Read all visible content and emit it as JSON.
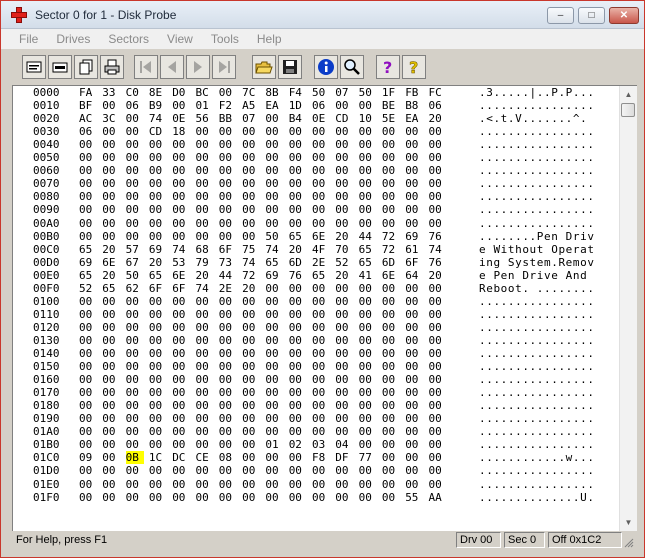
{
  "window": {
    "title": "Sector 0 for 1 - Disk Probe"
  },
  "menu": {
    "items": [
      "File",
      "Drives",
      "Sectors",
      "View",
      "Tools",
      "Help"
    ]
  },
  "toolbar": {
    "buttons": [
      {
        "icon": "read-sectors-icon",
        "enabled": true
      },
      {
        "icon": "write-sectors-icon",
        "enabled": true
      },
      {
        "icon": "copy-icon",
        "enabled": true
      },
      {
        "icon": "print-icon",
        "enabled": true
      },
      {
        "icon": "first-sector-icon",
        "enabled": false
      },
      {
        "icon": "previous-sector-icon",
        "enabled": false
      },
      {
        "icon": "next-sector-icon",
        "enabled": false
      },
      {
        "icon": "last-sector-icon",
        "enabled": false
      },
      {
        "icon": "open-folder-icon",
        "enabled": true
      },
      {
        "icon": "save-icon",
        "enabled": true
      },
      {
        "icon": "info-icon",
        "enabled": true
      },
      {
        "icon": "find-icon",
        "enabled": true
      },
      {
        "icon": "help-icon",
        "enabled": true
      },
      {
        "icon": "context-help-icon",
        "enabled": true
      }
    ]
  },
  "hex_rows": [
    {
      "addr": "0000",
      "bytes": [
        "FA",
        "33",
        "C0",
        "8E",
        "D0",
        "BC",
        "00",
        "7C",
        "8B",
        "F4",
        "50",
        "07",
        "50",
        "1F",
        "FB",
        "FC"
      ],
      "ascii": ".3.....|..P.P..."
    },
    {
      "addr": "0010",
      "bytes": [
        "BF",
        "00",
        "06",
        "B9",
        "00",
        "01",
        "F2",
        "A5",
        "EA",
        "1D",
        "06",
        "00",
        "00",
        "BE",
        "B8",
        "06"
      ],
      "ascii": "................"
    },
    {
      "addr": "0020",
      "bytes": [
        "AC",
        "3C",
        "00",
        "74",
        "0E",
        "56",
        "BB",
        "07",
        "00",
        "B4",
        "0E",
        "CD",
        "10",
        "5E",
        "EA",
        "20"
      ],
      "ascii": ".<.t.V.......^. "
    },
    {
      "addr": "0030",
      "bytes": [
        "06",
        "00",
        "00",
        "CD",
        "18",
        "00",
        "00",
        "00",
        "00",
        "00",
        "00",
        "00",
        "00",
        "00",
        "00",
        "00"
      ],
      "ascii": "................"
    },
    {
      "addr": "0040",
      "bytes": [
        "00",
        "00",
        "00",
        "00",
        "00",
        "00",
        "00",
        "00",
        "00",
        "00",
        "00",
        "00",
        "00",
        "00",
        "00",
        "00"
      ],
      "ascii": "................"
    },
    {
      "addr": "0050",
      "bytes": [
        "00",
        "00",
        "00",
        "00",
        "00",
        "00",
        "00",
        "00",
        "00",
        "00",
        "00",
        "00",
        "00",
        "00",
        "00",
        "00"
      ],
      "ascii": "................"
    },
    {
      "addr": "0060",
      "bytes": [
        "00",
        "00",
        "00",
        "00",
        "00",
        "00",
        "00",
        "00",
        "00",
        "00",
        "00",
        "00",
        "00",
        "00",
        "00",
        "00"
      ],
      "ascii": "................"
    },
    {
      "addr": "0070",
      "bytes": [
        "00",
        "00",
        "00",
        "00",
        "00",
        "00",
        "00",
        "00",
        "00",
        "00",
        "00",
        "00",
        "00",
        "00",
        "00",
        "00"
      ],
      "ascii": "................"
    },
    {
      "addr": "0080",
      "bytes": [
        "00",
        "00",
        "00",
        "00",
        "00",
        "00",
        "00",
        "00",
        "00",
        "00",
        "00",
        "00",
        "00",
        "00",
        "00",
        "00"
      ],
      "ascii": "................"
    },
    {
      "addr": "0090",
      "bytes": [
        "00",
        "00",
        "00",
        "00",
        "00",
        "00",
        "00",
        "00",
        "00",
        "00",
        "00",
        "00",
        "00",
        "00",
        "00",
        "00"
      ],
      "ascii": "................"
    },
    {
      "addr": "00A0",
      "bytes": [
        "00",
        "00",
        "00",
        "00",
        "00",
        "00",
        "00",
        "00",
        "00",
        "00",
        "00",
        "00",
        "00",
        "00",
        "00",
        "00"
      ],
      "ascii": "................"
    },
    {
      "addr": "00B0",
      "bytes": [
        "00",
        "00",
        "00",
        "00",
        "00",
        "00",
        "00",
        "00",
        "50",
        "65",
        "6E",
        "20",
        "44",
        "72",
        "69",
        "76"
      ],
      "ascii": "........Pen Driv"
    },
    {
      "addr": "00C0",
      "bytes": [
        "65",
        "20",
        "57",
        "69",
        "74",
        "68",
        "6F",
        "75",
        "74",
        "20",
        "4F",
        "70",
        "65",
        "72",
        "61",
        "74"
      ],
      "ascii": "e Without Operat"
    },
    {
      "addr": "00D0",
      "bytes": [
        "69",
        "6E",
        "67",
        "20",
        "53",
        "79",
        "73",
        "74",
        "65",
        "6D",
        "2E",
        "52",
        "65",
        "6D",
        "6F",
        "76"
      ],
      "ascii": "ing System.Remov"
    },
    {
      "addr": "00E0",
      "bytes": [
        "65",
        "20",
        "50",
        "65",
        "6E",
        "20",
        "44",
        "72",
        "69",
        "76",
        "65",
        "20",
        "41",
        "6E",
        "64",
        "20"
      ],
      "ascii": "e Pen Drive And "
    },
    {
      "addr": "00F0",
      "bytes": [
        "52",
        "65",
        "62",
        "6F",
        "6F",
        "74",
        "2E",
        "20",
        "00",
        "00",
        "00",
        "00",
        "00",
        "00",
        "00",
        "00"
      ],
      "ascii": "Reboot. ........"
    },
    {
      "addr": "0100",
      "bytes": [
        "00",
        "00",
        "00",
        "00",
        "00",
        "00",
        "00",
        "00",
        "00",
        "00",
        "00",
        "00",
        "00",
        "00",
        "00",
        "00"
      ],
      "ascii": "................"
    },
    {
      "addr": "0110",
      "bytes": [
        "00",
        "00",
        "00",
        "00",
        "00",
        "00",
        "00",
        "00",
        "00",
        "00",
        "00",
        "00",
        "00",
        "00",
        "00",
        "00"
      ],
      "ascii": "................"
    },
    {
      "addr": "0120",
      "bytes": [
        "00",
        "00",
        "00",
        "00",
        "00",
        "00",
        "00",
        "00",
        "00",
        "00",
        "00",
        "00",
        "00",
        "00",
        "00",
        "00"
      ],
      "ascii": "................"
    },
    {
      "addr": "0130",
      "bytes": [
        "00",
        "00",
        "00",
        "00",
        "00",
        "00",
        "00",
        "00",
        "00",
        "00",
        "00",
        "00",
        "00",
        "00",
        "00",
        "00"
      ],
      "ascii": "................"
    },
    {
      "addr": "0140",
      "bytes": [
        "00",
        "00",
        "00",
        "00",
        "00",
        "00",
        "00",
        "00",
        "00",
        "00",
        "00",
        "00",
        "00",
        "00",
        "00",
        "00"
      ],
      "ascii": "................"
    },
    {
      "addr": "0150",
      "bytes": [
        "00",
        "00",
        "00",
        "00",
        "00",
        "00",
        "00",
        "00",
        "00",
        "00",
        "00",
        "00",
        "00",
        "00",
        "00",
        "00"
      ],
      "ascii": "................"
    },
    {
      "addr": "0160",
      "bytes": [
        "00",
        "00",
        "00",
        "00",
        "00",
        "00",
        "00",
        "00",
        "00",
        "00",
        "00",
        "00",
        "00",
        "00",
        "00",
        "00"
      ],
      "ascii": "................"
    },
    {
      "addr": "0170",
      "bytes": [
        "00",
        "00",
        "00",
        "00",
        "00",
        "00",
        "00",
        "00",
        "00",
        "00",
        "00",
        "00",
        "00",
        "00",
        "00",
        "00"
      ],
      "ascii": "................"
    },
    {
      "addr": "0180",
      "bytes": [
        "00",
        "00",
        "00",
        "00",
        "00",
        "00",
        "00",
        "00",
        "00",
        "00",
        "00",
        "00",
        "00",
        "00",
        "00",
        "00"
      ],
      "ascii": "................"
    },
    {
      "addr": "0190",
      "bytes": [
        "00",
        "00",
        "00",
        "00",
        "00",
        "00",
        "00",
        "00",
        "00",
        "00",
        "00",
        "00",
        "00",
        "00",
        "00",
        "00"
      ],
      "ascii": "................"
    },
    {
      "addr": "01A0",
      "bytes": [
        "00",
        "00",
        "00",
        "00",
        "00",
        "00",
        "00",
        "00",
        "00",
        "00",
        "00",
        "00",
        "00",
        "00",
        "00",
        "00"
      ],
      "ascii": "................"
    },
    {
      "addr": "01B0",
      "bytes": [
        "00",
        "00",
        "00",
        "00",
        "00",
        "00",
        "00",
        "00",
        "01",
        "02",
        "03",
        "04",
        "00",
        "00",
        "00",
        "00"
      ],
      "ascii": "................"
    },
    {
      "addr": "01C0",
      "bytes": [
        "09",
        "00",
        "0B",
        "1C",
        "DC",
        "CE",
        "08",
        "00",
        "00",
        "00",
        "F8",
        "DF",
        "77",
        "00",
        "00",
        "00"
      ],
      "ascii": "............w...",
      "highlight": 2
    },
    {
      "addr": "01D0",
      "bytes": [
        "00",
        "00",
        "00",
        "00",
        "00",
        "00",
        "00",
        "00",
        "00",
        "00",
        "00",
        "00",
        "00",
        "00",
        "00",
        "00"
      ],
      "ascii": "................"
    },
    {
      "addr": "01E0",
      "bytes": [
        "00",
        "00",
        "00",
        "00",
        "00",
        "00",
        "00",
        "00",
        "00",
        "00",
        "00",
        "00",
        "00",
        "00",
        "00",
        "00"
      ],
      "ascii": "................"
    },
    {
      "addr": "01F0",
      "bytes": [
        "00",
        "00",
        "00",
        "00",
        "00",
        "00",
        "00",
        "00",
        "00",
        "00",
        "00",
        "00",
        "00",
        "00",
        "55",
        "AA"
      ],
      "ascii": "..............U."
    }
  ],
  "status": {
    "help": "For Help, press F1",
    "drive": "Drv 00",
    "sector": "Sec 0",
    "offset": "Off 0x1C2"
  },
  "colors": {
    "highlight": "#ffff00",
    "window_border": "#c9372c"
  }
}
